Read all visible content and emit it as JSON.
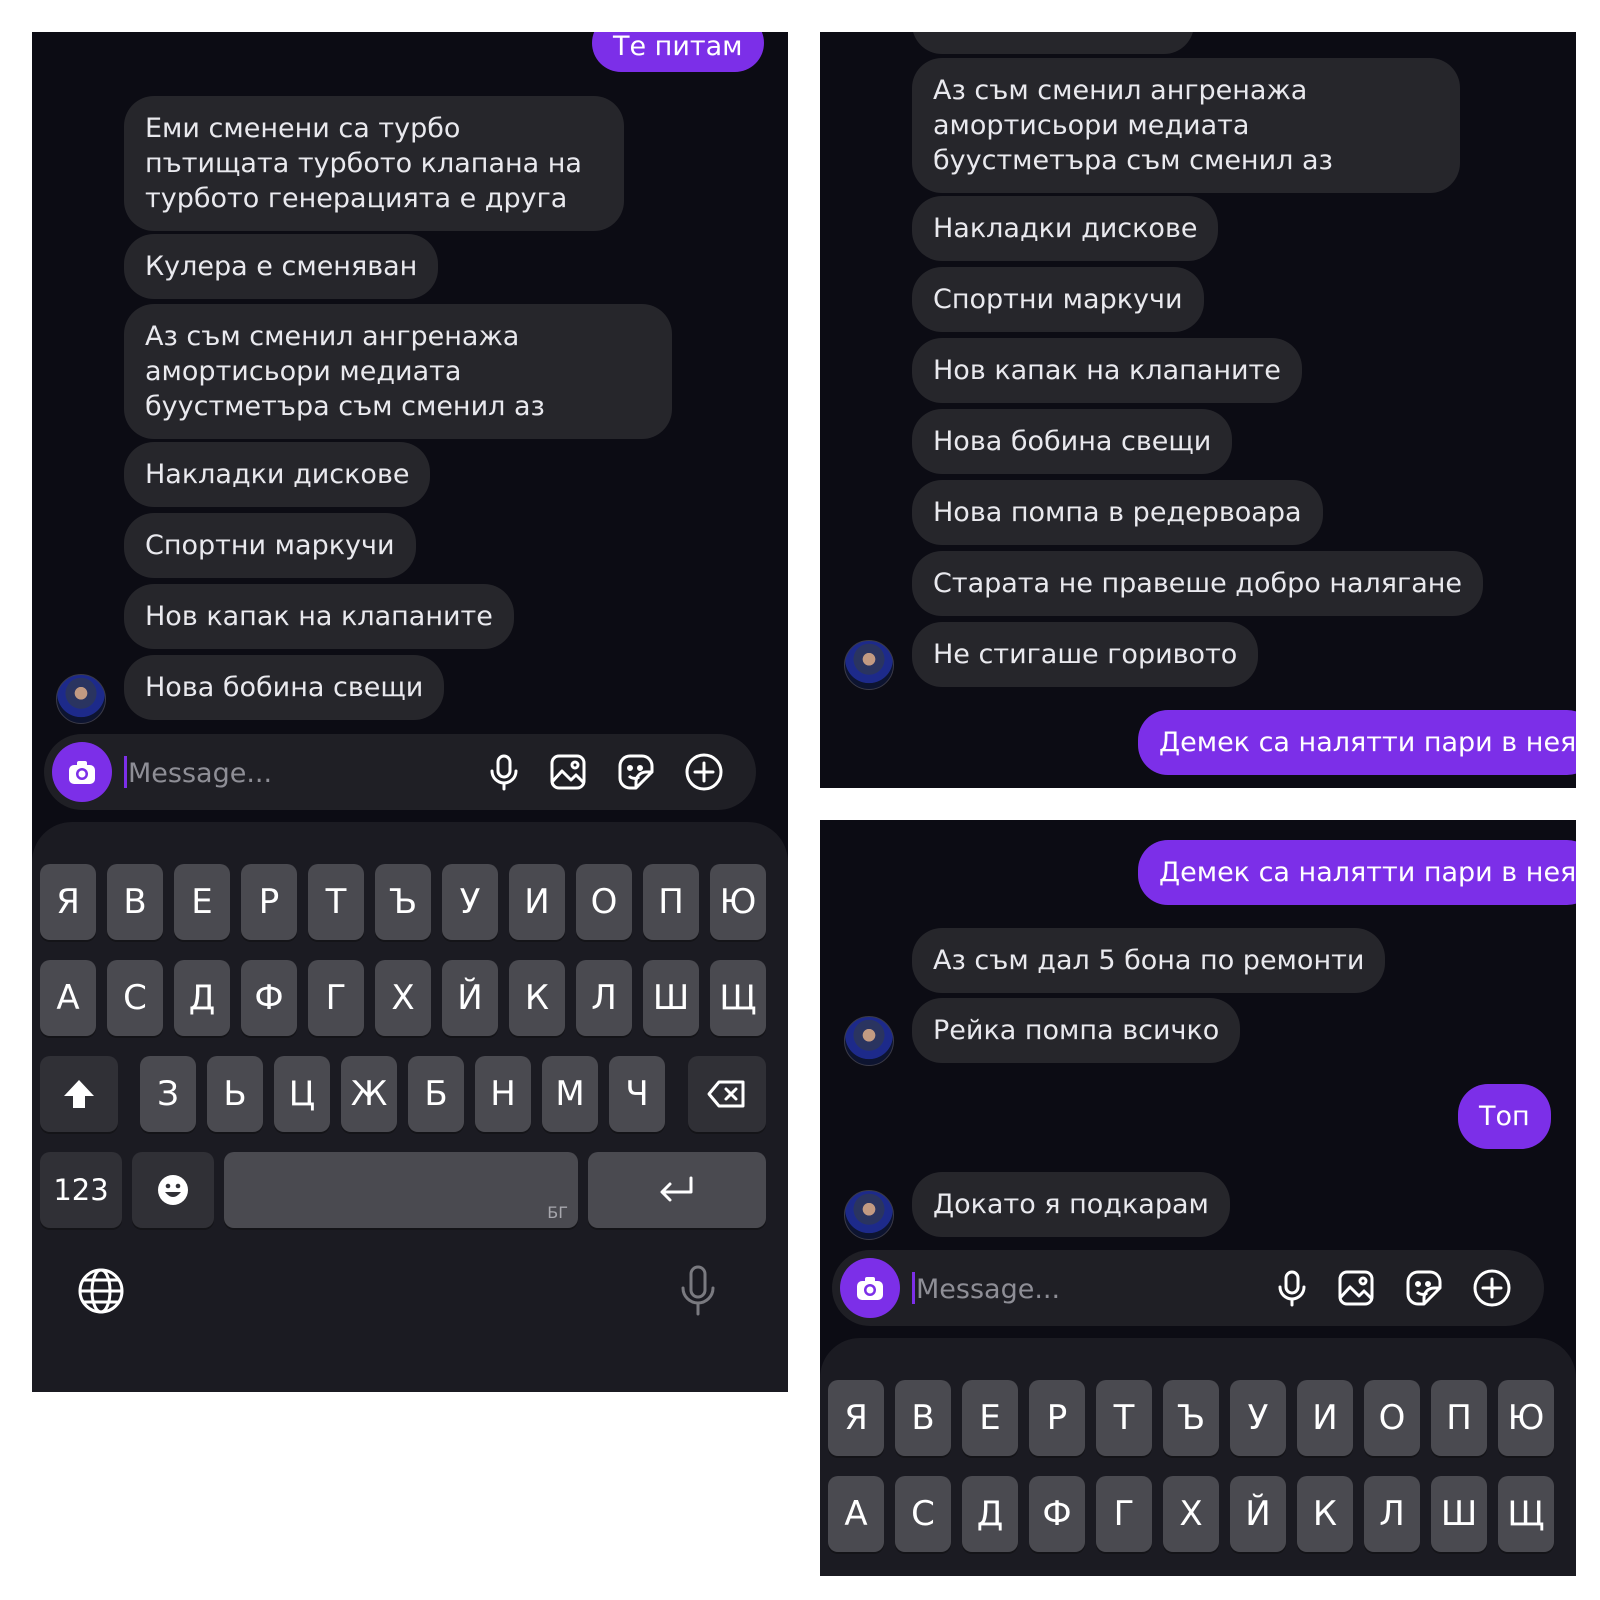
{
  "left": {
    "top_cut_message": "Те питам",
    "messages": [
      "Еми сменени са турбо пътищата турбото клапана на турбото генерацията е друга",
      "Кулера е сменяван",
      "Аз съм сменил ангренажа амортисьори медиата буустметъра съм сменил аз",
      "Накладки дискове",
      "Спортни маркучи",
      "Нов капак на клапаните",
      "Нова бобина свещи"
    ],
    "composer": {
      "placeholder": "Message..."
    },
    "keyboard": {
      "row1": [
        "Я",
        "В",
        "Е",
        "Р",
        "Т",
        "Ъ",
        "У",
        "И",
        "О",
        "П",
        "Ю"
      ],
      "row2": [
        "А",
        "С",
        "Д",
        "Ф",
        "Г",
        "Х",
        "Й",
        "К",
        "Л",
        "Ш",
        "Щ"
      ],
      "row3": [
        "З",
        "Ь",
        "Ц",
        "Ж",
        "Б",
        "Н",
        "М",
        "Ч"
      ],
      "numbers_key": "123",
      "space_lang": "БГ"
    }
  },
  "top_right": {
    "messages": [
      "Аз съм сменил ангренажа амортисьори медиата буустметъра съм сменил аз",
      "Накладки дискове",
      "Спортни маркучи",
      "Нов капак на клапаните",
      "Нова бобина свещи",
      "Нова помпа в редервоара",
      "Старата не правеше добро налягане",
      "Не стигаше горивото"
    ],
    "outgoing": "Демек са налятти пари в нея"
  },
  "bottom_right": {
    "outgoing_1": "Демек са налятти пари в нея",
    "incoming_1": "Аз съм дал 5 бона по ремонти",
    "incoming_2": "Рейка помпа всичко",
    "outgoing_2": "Топ",
    "incoming_3": "Докато я подкарам",
    "composer": {
      "placeholder": "Message..."
    },
    "keyboard": {
      "row1": [
        "Я",
        "В",
        "Е",
        "Р",
        "Т",
        "Ъ",
        "У",
        "И",
        "О",
        "П",
        "Ю"
      ],
      "row2": [
        "А",
        "С",
        "Д",
        "Ф",
        "Г",
        "Х",
        "Й",
        "К",
        "Л",
        "Ш",
        "Щ"
      ]
    }
  },
  "colors": {
    "accent": "#7c2fe8",
    "bubble": "#26262b",
    "background": "#0c0c14"
  },
  "icons": [
    "camera-icon",
    "microphone-icon",
    "image-icon",
    "sticker-icon",
    "plus-circle-icon",
    "shift-icon",
    "backspace-icon",
    "emoji-icon",
    "return-icon",
    "globe-icon",
    "dictation-mic-icon"
  ]
}
